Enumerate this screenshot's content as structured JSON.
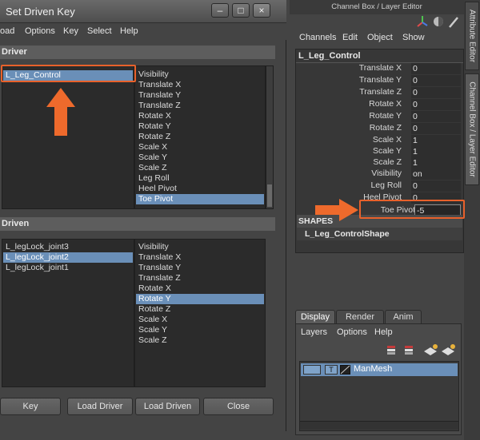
{
  "sdk": {
    "title": "Set Driven Key",
    "window_buttons": [
      "–",
      "□",
      "×"
    ],
    "menu": [
      "oad",
      "Options",
      "Key",
      "Select",
      "Help"
    ],
    "driver": {
      "header": "Driver",
      "objects": [
        "L_Leg_Control"
      ],
      "attributes": [
        "Visibility",
        "Translate X",
        "Translate Y",
        "Translate Z",
        "Rotate X",
        "Rotate Y",
        "Rotate Z",
        "Scale X",
        "Scale Y",
        "Scale Z",
        "Leg Roll",
        "Heel Pivot",
        "Toe Pivot"
      ]
    },
    "driven": {
      "header": "Driven",
      "objects": [
        "L_legLock_joint3",
        "L_legLock_joint2",
        "L_legLock_joint1"
      ],
      "attributes": [
        "Visibility",
        "Translate X",
        "Translate Y",
        "Translate Z",
        "Rotate X",
        "Rotate Y",
        "Rotate Z",
        "Scale X",
        "Scale Y",
        "Scale Z"
      ]
    },
    "buttons": {
      "key": "Key",
      "load_driver": "Load Driver",
      "load_driven": "Load Driven",
      "close": "Close"
    }
  },
  "channel_box": {
    "title": "Channel Box / Layer Editor",
    "menu": [
      "Channels",
      "Edit",
      "Object",
      "Show"
    ],
    "object_name": "L_Leg_Control",
    "attributes": [
      {
        "label": "Translate X",
        "value": "0"
      },
      {
        "label": "Translate Y",
        "value": "0"
      },
      {
        "label": "Translate Z",
        "value": "0"
      },
      {
        "label": "Rotate X",
        "value": "0"
      },
      {
        "label": "Rotate Y",
        "value": "0"
      },
      {
        "label": "Rotate Z",
        "value": "0"
      },
      {
        "label": "Scale X",
        "value": "1"
      },
      {
        "label": "Scale Y",
        "value": "1"
      },
      {
        "label": "Scale Z",
        "value": "1"
      },
      {
        "label": "Visibility",
        "value": "on"
      },
      {
        "label": "Leg Roll",
        "value": "0"
      },
      {
        "label": "Heel Pivot",
        "value": "0"
      },
      {
        "label": "Toe Pivot",
        "value": "-5"
      }
    ],
    "shapes_header": "SHAPES",
    "shape_name": "L_Leg_ControlShape",
    "side_tabs": [
      "Attribute Editor",
      "Channel Box / Layer Editor"
    ]
  },
  "layer_editor": {
    "tabs": [
      "Display",
      "Render",
      "Anim"
    ],
    "menu": [
      "Layers",
      "Options",
      "Help"
    ],
    "layer": {
      "template_flag": "T",
      "name": "ManMesh"
    }
  },
  "colors": {
    "highlight": "#e8612b",
    "selection": "#6a8fb8"
  }
}
